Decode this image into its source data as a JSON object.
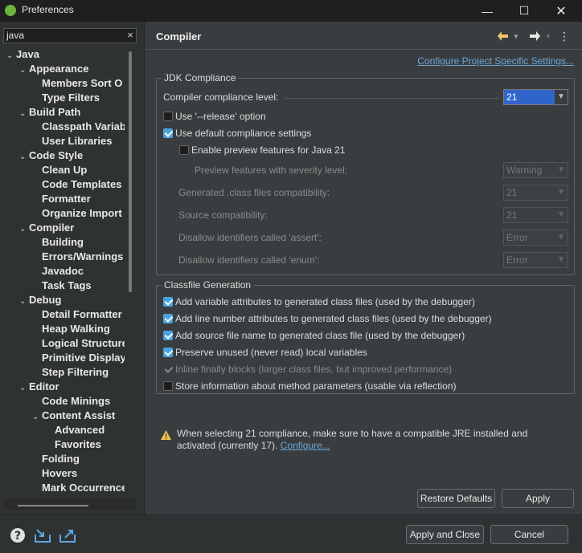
{
  "window": {
    "title": "Preferences"
  },
  "filter": {
    "value": "java",
    "clear_glyph": "×"
  },
  "tree": [
    {
      "label": "Java",
      "expanded": true
    },
    {
      "label": "Appearance",
      "expanded": true
    },
    {
      "label": "Members Sort O"
    },
    {
      "label": "Type Filters"
    },
    {
      "label": "Build Path",
      "expanded": true
    },
    {
      "label": "Classpath Variab"
    },
    {
      "label": "User Libraries"
    },
    {
      "label": "Code Style",
      "expanded": true
    },
    {
      "label": "Clean Up"
    },
    {
      "label": "Code Templates"
    },
    {
      "label": "Formatter"
    },
    {
      "label": "Organize Import"
    },
    {
      "label": "Compiler",
      "expanded": true,
      "selected": true
    },
    {
      "label": "Building"
    },
    {
      "label": "Errors/Warnings"
    },
    {
      "label": "Javadoc"
    },
    {
      "label": "Task Tags"
    },
    {
      "label": "Debug",
      "expanded": true
    },
    {
      "label": "Detail Formatter"
    },
    {
      "label": "Heap Walking"
    },
    {
      "label": "Logical Structure"
    },
    {
      "label": "Primitive Display"
    },
    {
      "label": "Step Filtering"
    },
    {
      "label": "Editor",
      "expanded": true
    },
    {
      "label": "Code Minings"
    },
    {
      "label": "Content Assist",
      "expanded": true
    },
    {
      "label": "Advanced"
    },
    {
      "label": "Favorites"
    },
    {
      "label": "Folding"
    },
    {
      "label": "Hovers"
    },
    {
      "label": "Mark Occurrence"
    }
  ],
  "page": {
    "title": "Compiler",
    "configure_link": "Configure Project Specific Settings...",
    "jdk_group": "JDK Compliance",
    "compliance_label": "Compiler compliance level:",
    "compliance_value": "21",
    "use_release": "Use '--release' option",
    "use_default": "Use default compliance settings",
    "enable_preview": "Enable preview features for Java 21",
    "preview_severity_label": "Preview features with severity level:",
    "preview_severity_value": "Warning",
    "generated_label": "Generated .class files compatibility:",
    "generated_value": "21",
    "source_label": "Source compatibility:",
    "source_value": "21",
    "assert_label": "Disallow identifiers called 'assert':",
    "assert_value": "Error",
    "enum_label": "Disallow identifiers called 'enum':",
    "enum_value": "Error",
    "classfile_group": "Classfile Generation",
    "cf_variable": "Add variable attributes to generated class files (used by the debugger)",
    "cf_line": "Add line number attributes to generated class files (used by the debugger)",
    "cf_source": "Add source file name to generated class file (used by the debugger)",
    "cf_preserve": "Preserve unused (never read) local variables",
    "cf_inline": "Inline finally blocks (larger class files, but improved performance)",
    "cf_store": "Store information about method parameters (usable via reflection)",
    "warning_text": "When selecting 21 compliance, make sure to have a compatible JRE installed and activated (currently 17).",
    "warning_link": "Configure...",
    "restore_defaults": "Restore Defaults",
    "apply": "Apply"
  },
  "footer": {
    "apply_and_close": "Apply and Close",
    "cancel": "Cancel"
  },
  "colors": {
    "accent": "#4aa3df",
    "link": "#6aa6d8",
    "combo_active": "#2f65ca"
  }
}
